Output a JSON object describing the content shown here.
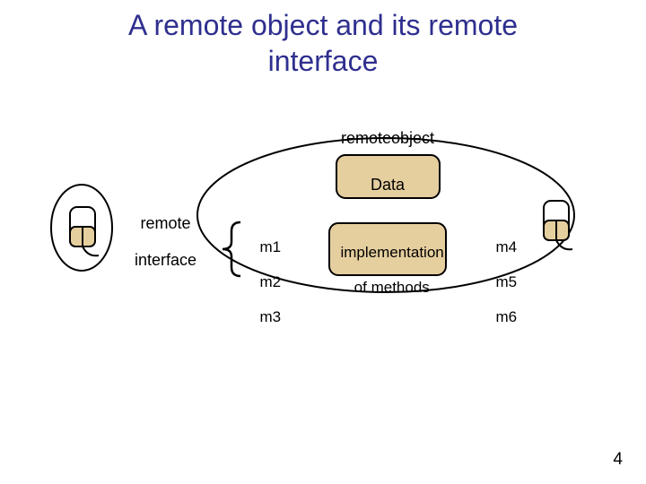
{
  "title_line1": "A remote object and its remote",
  "title_line2": "interface",
  "labels": {
    "remote_object": "remoteobject",
    "remote_interface_l1": "remote",
    "remote_interface_l2": "interface",
    "data": "Data",
    "impl_l1": "implementation",
    "impl_l2": "of methods",
    "left_methods_l1": "m1",
    "left_methods_l2": "m2",
    "left_methods_l3": "m3",
    "right_methods_l1": "m4",
    "right_methods_l2": "m5",
    "right_methods_l3": "m6"
  },
  "page_number": "4",
  "colors": {
    "title": "#2f2f8f",
    "fill_tan": "#e6cf9f",
    "outline": "#000000"
  }
}
